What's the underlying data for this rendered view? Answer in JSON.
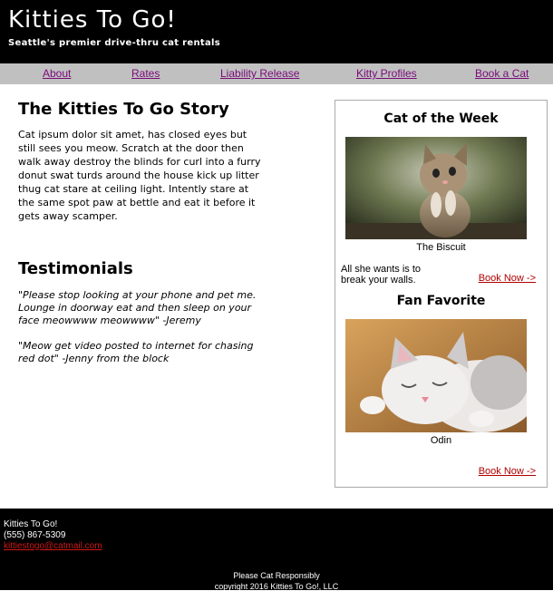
{
  "header": {
    "title": "Kitties To Go!",
    "tagline": "Seattle's premier drive-thru cat rentals"
  },
  "nav": {
    "items": [
      {
        "label": "About"
      },
      {
        "label": "Rates"
      },
      {
        "label": "Liability Release"
      },
      {
        "label": "Kitty Profiles"
      },
      {
        "label": "Book a Cat"
      }
    ]
  },
  "main": {
    "story_title": "The Kitties To Go Story",
    "story_text": "Cat ipsum dolor sit amet, has closed eyes but still sees you meow. Scratch at the door then walk away destroy the blinds for curl into a furry donut swat turds around the house kick up litter thug cat stare at ceiling light. Intently stare at the same spot paw at bettle and eat it before it gets away scamper.",
    "testimonials_title": "Testimonials",
    "testimonials": [
      {
        "text": "\"Please stop looking at your phone and pet me. Lounge in doorway eat and then sleep on your face meowwww meowwww\" -Jeremy"
      },
      {
        "text": "\"Meow get video posted to internet for chasing red dot\" -Jenny from the block"
      }
    ]
  },
  "sidebar": {
    "cat_of_week": {
      "heading": "Cat of the Week",
      "name": "The Biscuit",
      "blurb": "All she wants is to break your walls.",
      "book_label": "Book Now ->"
    },
    "fan_favorite": {
      "heading": "Fan Favorite",
      "name": "Odin",
      "book_label": "Book Now ->"
    }
  },
  "footer": {
    "company": "Kitties To Go!",
    "phone": "(555) 867-5309",
    "email": "kittiestogo@catmail.com",
    "slogan": "Please Cat Responsibly",
    "copyright": "copyright 2016 Kitties To Go!, LLC"
  },
  "colors": {
    "nav_link": "#7a0a7a",
    "book_link": "#b00000",
    "header_bg": "#000000",
    "nav_bg": "#c0c0c0"
  }
}
